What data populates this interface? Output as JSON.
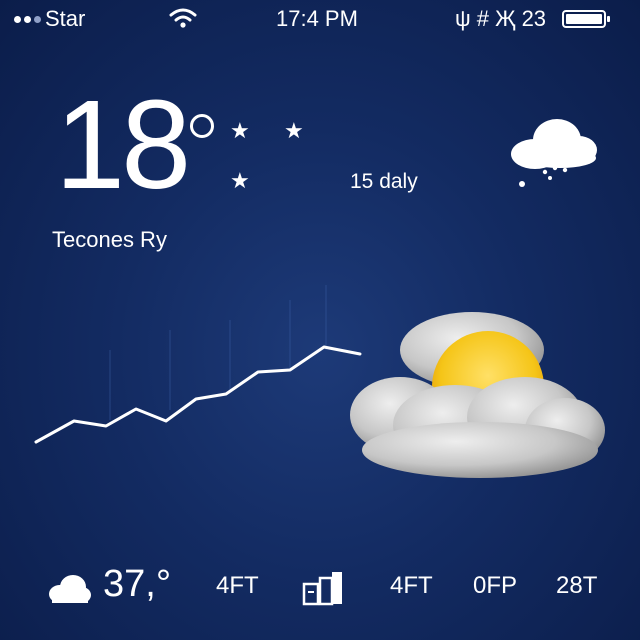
{
  "status_bar": {
    "carrier": "Star",
    "time": "17:4 PM",
    "indicators": "ψ # Җ 23"
  },
  "current": {
    "temperature": "18",
    "degree_symbol": "°",
    "daily_label": "15 daly",
    "location": "Tecones Ry"
  },
  "bottom": {
    "temperature": "37,°",
    "item1": "4FT",
    "item2": "4FT",
    "item3": "0FP",
    "item4": "28T"
  },
  "icons": [
    "wifi-icon",
    "battery-icon",
    "cloud-rain-icon",
    "sun-cloud-icon",
    "cloud-icon",
    "buildings-icon",
    "star-icon"
  ],
  "colors": {
    "background": "#132b62",
    "text": "#ffffff",
    "sun": "#f5c518",
    "cloud": "#c9c9c9"
  }
}
